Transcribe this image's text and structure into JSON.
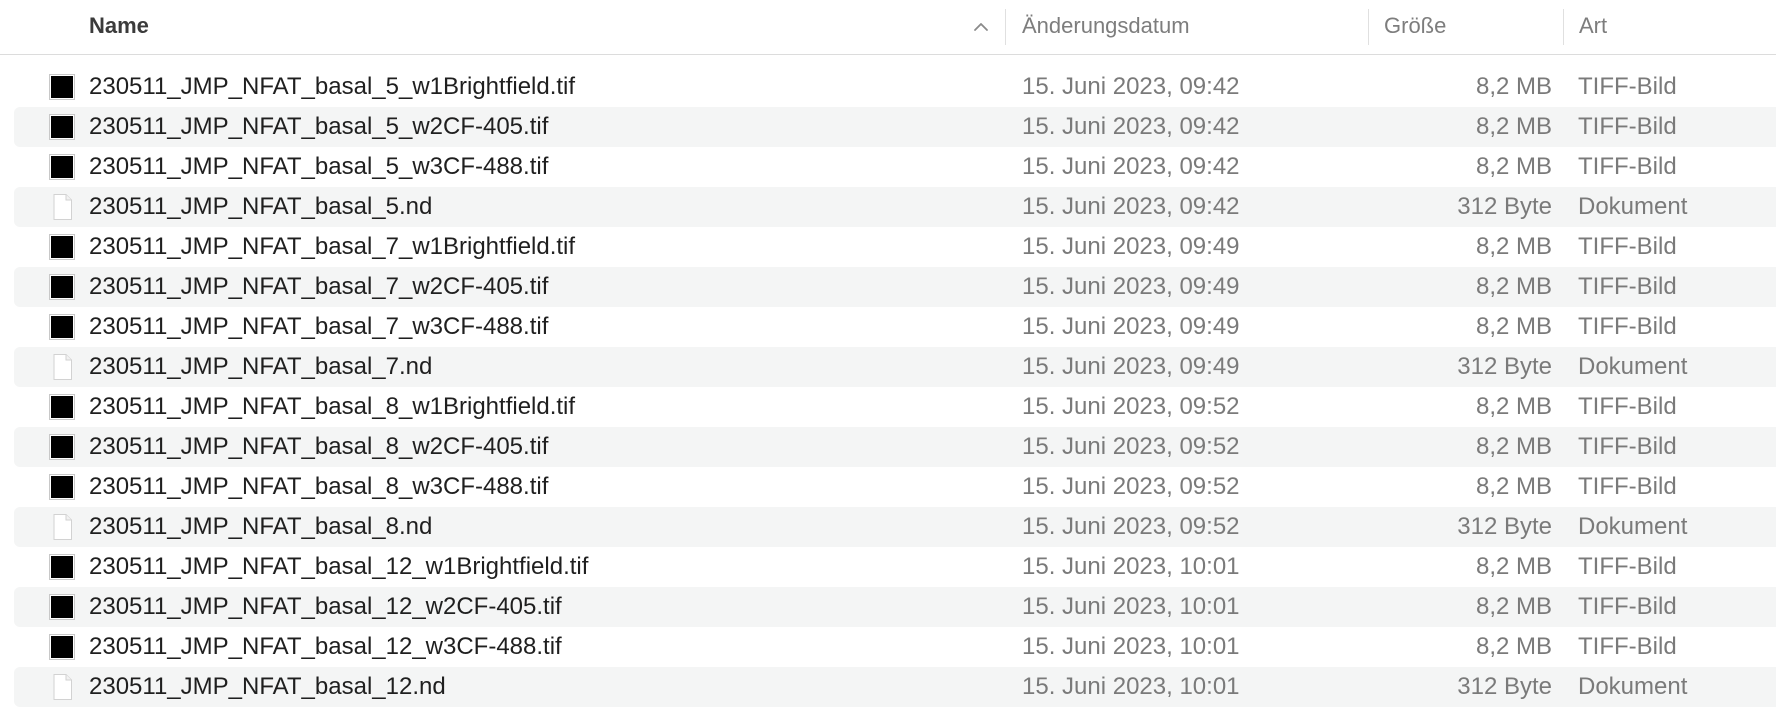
{
  "header": {
    "name_label": "Name",
    "date_label": "Änderungsdatum",
    "size_label": "Größe",
    "kind_label": "Art",
    "sort_column": "name",
    "sort_direction": "ascending"
  },
  "colors": {
    "row_alt_bg": "#f4f5f5",
    "header_text": "#7d7d7d",
    "secondary_text": "#7a7a7a"
  },
  "files": [
    {
      "name": "230511_JMP_NFAT_basal_5_w1Brightfield.tif",
      "date": "15. Juni 2023, 09:42",
      "size": "8,2 MB",
      "kind": "TIFF-Bild",
      "icon": "tiff-image-icon"
    },
    {
      "name": "230511_JMP_NFAT_basal_5_w2CF-405.tif",
      "date": "15. Juni 2023, 09:42",
      "size": "8,2 MB",
      "kind": "TIFF-Bild",
      "icon": "tiff-image-icon"
    },
    {
      "name": "230511_JMP_NFAT_basal_5_w3CF-488.tif",
      "date": "15. Juni 2023, 09:42",
      "size": "8,2 MB",
      "kind": "TIFF-Bild",
      "icon": "tiff-image-icon"
    },
    {
      "name": "230511_JMP_NFAT_basal_5.nd",
      "date": "15. Juni 2023, 09:42",
      "size": "312 Byte",
      "kind": "Dokument",
      "icon": "document-icon"
    },
    {
      "name": "230511_JMP_NFAT_basal_7_w1Brightfield.tif",
      "date": "15. Juni 2023, 09:49",
      "size": "8,2 MB",
      "kind": "TIFF-Bild",
      "icon": "tiff-image-icon"
    },
    {
      "name": "230511_JMP_NFAT_basal_7_w2CF-405.tif",
      "date": "15. Juni 2023, 09:49",
      "size": "8,2 MB",
      "kind": "TIFF-Bild",
      "icon": "tiff-image-icon"
    },
    {
      "name": "230511_JMP_NFAT_basal_7_w3CF-488.tif",
      "date": "15. Juni 2023, 09:49",
      "size": "8,2 MB",
      "kind": "TIFF-Bild",
      "icon": "tiff-image-icon"
    },
    {
      "name": "230511_JMP_NFAT_basal_7.nd",
      "date": "15. Juni 2023, 09:49",
      "size": "312 Byte",
      "kind": "Dokument",
      "icon": "document-icon"
    },
    {
      "name": "230511_JMP_NFAT_basal_8_w1Brightfield.tif",
      "date": "15. Juni 2023, 09:52",
      "size": "8,2 MB",
      "kind": "TIFF-Bild",
      "icon": "tiff-image-icon"
    },
    {
      "name": "230511_JMP_NFAT_basal_8_w2CF-405.tif",
      "date": "15. Juni 2023, 09:52",
      "size": "8,2 MB",
      "kind": "TIFF-Bild",
      "icon": "tiff-image-icon"
    },
    {
      "name": "230511_JMP_NFAT_basal_8_w3CF-488.tif",
      "date": "15. Juni 2023, 09:52",
      "size": "8,2 MB",
      "kind": "TIFF-Bild",
      "icon": "tiff-image-icon"
    },
    {
      "name": "230511_JMP_NFAT_basal_8.nd",
      "date": "15. Juni 2023, 09:52",
      "size": "312 Byte",
      "kind": "Dokument",
      "icon": "document-icon"
    },
    {
      "name": "230511_JMP_NFAT_basal_12_w1Brightfield.tif",
      "date": "15. Juni 2023, 10:01",
      "size": "8,2 MB",
      "kind": "TIFF-Bild",
      "icon": "tiff-image-icon"
    },
    {
      "name": "230511_JMP_NFAT_basal_12_w2CF-405.tif",
      "date": "15. Juni 2023, 10:01",
      "size": "8,2 MB",
      "kind": "TIFF-Bild",
      "icon": "tiff-image-icon"
    },
    {
      "name": "230511_JMP_NFAT_basal_12_w3CF-488.tif",
      "date": "15. Juni 2023, 10:01",
      "size": "8,2 MB",
      "kind": "TIFF-Bild",
      "icon": "tiff-image-icon"
    },
    {
      "name": "230511_JMP_NFAT_basal_12.nd",
      "date": "15. Juni 2023, 10:01",
      "size": "312 Byte",
      "kind": "Dokument",
      "icon": "document-icon"
    }
  ]
}
